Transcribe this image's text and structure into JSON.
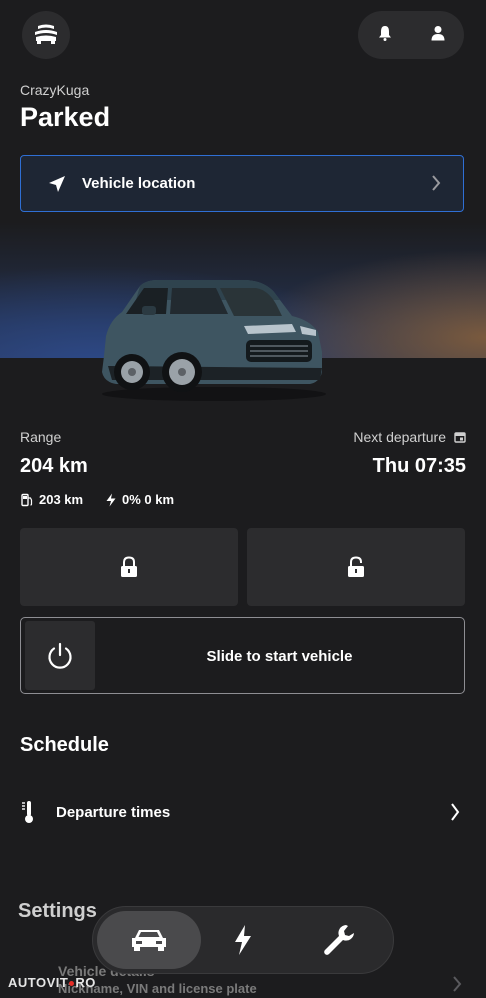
{
  "header": {
    "menu_icon": "car-front-icon",
    "notifications_icon": "bell-icon",
    "profile_icon": "person-icon"
  },
  "vehicle": {
    "nickname": "CrazyKuga",
    "status": "Parked"
  },
  "location_button": {
    "label": "Vehicle location",
    "icon": "navigation-arrow-icon"
  },
  "range": {
    "label": "Range",
    "value": "204 km",
    "fuel": "203 km",
    "electric": "0% 0 km"
  },
  "departure": {
    "label": "Next departure",
    "value": "Thu 07:35"
  },
  "controls": {
    "lock_icon": "lock-closed-icon",
    "unlock_icon": "lock-open-icon",
    "start_slider_label": "Slide to start vehicle"
  },
  "schedule": {
    "title": "Schedule",
    "departure_times_label": "Departure times"
  },
  "settings": {
    "title": "Settings",
    "vehicle_details_label": "Vehicle details",
    "vehicle_details_sub": "Nickname, VIN and license plate"
  },
  "tabbar": {
    "tabs": [
      "vehicle",
      "charging",
      "service"
    ],
    "active": "vehicle"
  },
  "watermark": {
    "text_left": "AUTOVIT",
    "text_right": "RO"
  },
  "colors": {
    "background": "#1c1c1e",
    "tile": "#2c2c2e",
    "accent_border": "#2f6fd4"
  }
}
